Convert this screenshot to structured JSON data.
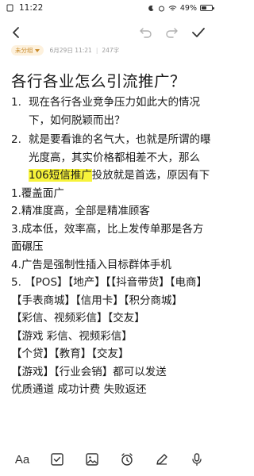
{
  "status": {
    "time": "11:22",
    "battery": "49%",
    "battery_level": 0.49
  },
  "meta": {
    "folder": "未分组",
    "datetime": "6月29日 11:21",
    "word_count": "247字"
  },
  "title": "各行各业怎么引流推广？",
  "list": [
    {
      "num": "1.",
      "text": "现在各行各业竞争压力如此大的情况下，如何脱颖而出？"
    },
    {
      "num": "2.",
      "text_before": "就是要看谁的名气大，也就是所谓的曝光度高，其实价格都相差不大，那么",
      "highlight": "106短信推广",
      "text_after": "投放就是首选，原因有下"
    }
  ],
  "points": [
    "1.覆盖面广",
    "2.精准度高，全部是精准顾客",
    "3.成本低，效率高，比上发传单那是各方面碾压",
    " 4.广告是强制性插入目标群体手机",
    " 5. 【POS】【地产】【【抖音带货】【电商】【手表商城】【信用卡】【积分商城】",
    "【彩信、视频彩信】【交友】",
    "【游戏 彩信、视频彩信】",
    "【个贷】【教育】【交友】",
    "【游戏】【行业会销】都可以发送",
    "优质通道 成功计费 失败返还"
  ],
  "icons": {
    "back": "chevron-left-icon",
    "undo": "undo-icon",
    "redo": "redo-icon",
    "done": "check-icon",
    "format": "text-format-icon",
    "checklist": "checkbox-icon",
    "image": "image-icon",
    "alarm": "alarm-clock-icon",
    "draw": "pen-icon",
    "voice": "microphone-icon"
  },
  "colors": {
    "highlight": "#f7f33a",
    "tag_text": "#c98a2a",
    "tag_bg": "#fdf1dd"
  },
  "bottombar": {
    "format_label": "Aa"
  }
}
